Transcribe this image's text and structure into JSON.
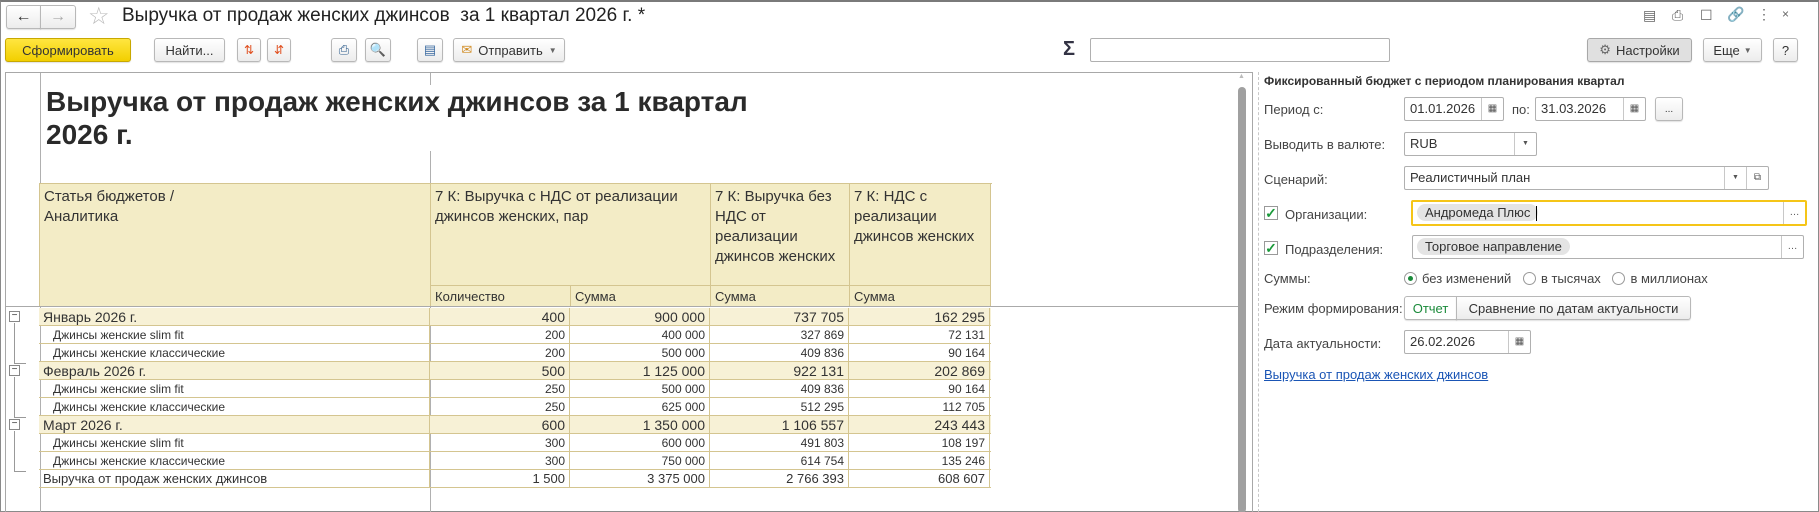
{
  "window": {
    "title": "Выручка от продаж женских джинсов  за 1 квартал 2026 г. *"
  },
  "toolbar": {
    "generate": "Сформировать",
    "find": "Найти...",
    "send": "Отправить",
    "sum_symbol": "Σ",
    "sum_value": "",
    "settings": "Настройки",
    "more": "Еще",
    "help": "?"
  },
  "report": {
    "title_line1": "Выручка от продаж женских джинсов за 1 квартал",
    "title_line2": "2026 г.",
    "headers": {
      "article": "Статья бюджетов / Аналитика",
      "col1": "7 К: Выручка с НДС от реализации джинсов женских, пар",
      "col2": "7 К: Выручка без НДС от реализации джинсов женских",
      "col3": "7 К: НДС с реализации джинсов женских",
      "qty": "Количество",
      "sum1": "Сумма",
      "sum2": "Сумма",
      "sum3": "Сумма"
    },
    "rows": [
      {
        "type": "grp",
        "name": "Январь 2026 г.",
        "qty": "400",
        "sum": "900 000",
        "net": "737 705",
        "vat": "162 295"
      },
      {
        "type": "sub",
        "name": "Джинсы женские slim fit",
        "qty": "200",
        "sum": "400 000",
        "net": "327 869",
        "vat": "72 131"
      },
      {
        "type": "sub",
        "name": "Джинсы женские классические",
        "qty": "200",
        "sum": "500 000",
        "net": "409 836",
        "vat": "90 164"
      },
      {
        "type": "grp",
        "name": "Февраль 2026 г.",
        "qty": "500",
        "sum": "1 125 000",
        "net": "922 131",
        "vat": "202 869"
      },
      {
        "type": "sub",
        "name": "Джинсы женские slim fit",
        "qty": "250",
        "sum": "500 000",
        "net": "409 836",
        "vat": "90 164"
      },
      {
        "type": "sub",
        "name": "Джинсы женские классические",
        "qty": "250",
        "sum": "625 000",
        "net": "512 295",
        "vat": "112 705"
      },
      {
        "type": "grp",
        "name": "Март 2026 г.",
        "qty": "600",
        "sum": "1 350 000",
        "net": "1 106 557",
        "vat": "243 443"
      },
      {
        "type": "sub",
        "name": "Джинсы женские slim fit",
        "qty": "300",
        "sum": "600 000",
        "net": "491 803",
        "vat": "108 197"
      },
      {
        "type": "sub",
        "name": "Джинсы женские классические",
        "qty": "300",
        "sum": "750 000",
        "net": "614 754",
        "vat": "135 246"
      },
      {
        "type": "total",
        "name": "Выручка от продаж женских джинсов",
        "qty": "1 500",
        "sum": "3 375 000",
        "net": "2 766 393",
        "vat": "608 607"
      }
    ]
  },
  "panel": {
    "heading": "Фиксированный бюджет с периодом планирования квартал",
    "period_label": "Период с:",
    "period_from": "01.01.2026",
    "period_to_label": "по:",
    "period_to": "31.03.2026",
    "period_more": "...",
    "currency_label": "Выводить в валюте:",
    "currency": "RUB",
    "scenario_label": "Сценарий:",
    "scenario": "Реалистичный план",
    "org_label": "Организации:",
    "org_checked": true,
    "org_value": "Андромеда Плюс",
    "dept_label": "Подразделения:",
    "dept_checked": true,
    "dept_value": "Торговое направление",
    "sums_label": "Суммы:",
    "sums_options": [
      "без изменений",
      "в тысячах",
      "в миллионах"
    ],
    "sums_selected": "без изменений",
    "mode_label": "Режим формирования:",
    "mode_options": [
      "Отчет",
      "Сравнение по датам актуальности"
    ],
    "mode_selected": "Отчет",
    "date_label": "Дата актуальности:",
    "date_value": "26.02.2026",
    "link": "Выручка от продаж женских джинсов"
  },
  "colors": {
    "accent_yellow": "#f2cf00",
    "header_bg": "#f3ecc6",
    "focus_border": "#f5c518",
    "link": "#1a55b5",
    "check": "#1a9a3a"
  }
}
